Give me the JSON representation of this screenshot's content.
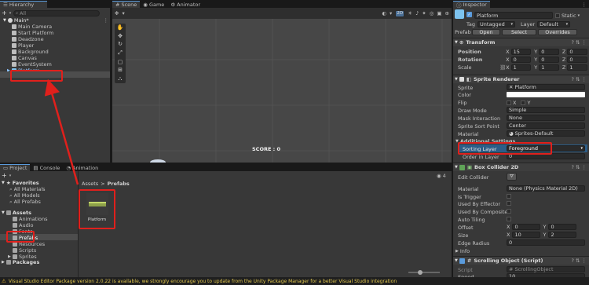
{
  "hierarchy": {
    "tab": "Hierarchy",
    "search_placeholder": "All",
    "scene": "Main*",
    "items": [
      "Main Camera",
      "Start Platform",
      "Deadzone",
      "Player",
      "Background",
      "Canvas",
      "EventSystem",
      "Platform"
    ]
  },
  "scene_view": {
    "tabs": [
      "Scene",
      "Game",
      "Animator"
    ],
    "mode": "2D",
    "overlay_text": "SCORE : 0"
  },
  "project": {
    "tabs": [
      "Project",
      "Console",
      "Animation"
    ],
    "favorites_label": "Favorites",
    "favorites": [
      "All Materials",
      "All Models",
      "All Prefabs"
    ],
    "assets_label": "Assets",
    "folders": [
      "Animations",
      "Audio",
      "Fonts",
      "Prefabs",
      "Resources",
      "Scripts",
      "Sprites"
    ],
    "packages_label": "Packages",
    "breadcrumb_root": "Assets",
    "breadcrumb_sep": ">",
    "breadcrumb_current": "Prefabs",
    "asset_name": "Platform",
    "count": "4"
  },
  "inspector": {
    "tab": "Inspector",
    "object_name": "Platform",
    "static_label": "Static",
    "tag_label": "Tag",
    "tag_value": "Untagged",
    "layer_label": "Layer",
    "layer_value": "Default",
    "prefab_label": "Prefab",
    "open": "Open",
    "select": "Select",
    "overrides": "Overrides",
    "transform": {
      "title": "Transform",
      "rows": [
        {
          "label": "Position",
          "x": "15",
          "y": "0",
          "z": "0"
        },
        {
          "label": "Rotation",
          "x": "0",
          "y": "0",
          "z": "0"
        },
        {
          "label": "Scale",
          "x": "1",
          "y": "1",
          "z": "1"
        }
      ]
    },
    "sprite_renderer": {
      "title": "Sprite Renderer",
      "sprite_label": "Sprite",
      "sprite_value": "Platform",
      "color_label": "Color",
      "flip_label": "Flip",
      "flip_x": "X",
      "flip_y": "Y",
      "draw_label": "Draw Mode",
      "draw_value": "Simple",
      "mask_label": "Mask Interaction",
      "mask_value": "None",
      "sort_point_label": "Sprite Sort Point",
      "sort_point_value": "Center",
      "material_label": "Material",
      "material_value": "Sprites-Default",
      "additional": "Additional Settings",
      "sorting_layer_label": "Sorting Layer",
      "sorting_layer_value": "Foreground",
      "order_label": "Order in Layer",
      "order_value": "0"
    },
    "box_collider": {
      "title": "Box Collider 2D",
      "edit_label": "Edit Collider",
      "material_label": "Material",
      "material_value": "None (Physics Material 2D)",
      "is_trigger": "Is Trigger",
      "used_effector": "Used By Effector",
      "used_composite": "Used By Composite",
      "auto_tiling": "Auto Tiling",
      "offset_label": "Offset",
      "offset_x": "0",
      "offset_y": "0",
      "size_label": "Size",
      "size_x": "10",
      "size_y": "2",
      "edge_label": "Edge Radius",
      "edge_value": "0",
      "info_label": "Info"
    },
    "scrolling": {
      "title": "Scrolling Object (Script)",
      "script_label": "Script",
      "script_value": "ScrollingObject",
      "speed_label": "Speed",
      "speed_value": "10"
    }
  },
  "status_bar": {
    "message": "Visual Studio Editor Package version 2.0.22 is available, we strongly encourage you to update from the Unity Package Manager for a better Visual Studio integration"
  },
  "colors": {
    "accent": "#5a9bdc",
    "highlight": "#e0201c",
    "selection": "#2c5d87"
  }
}
